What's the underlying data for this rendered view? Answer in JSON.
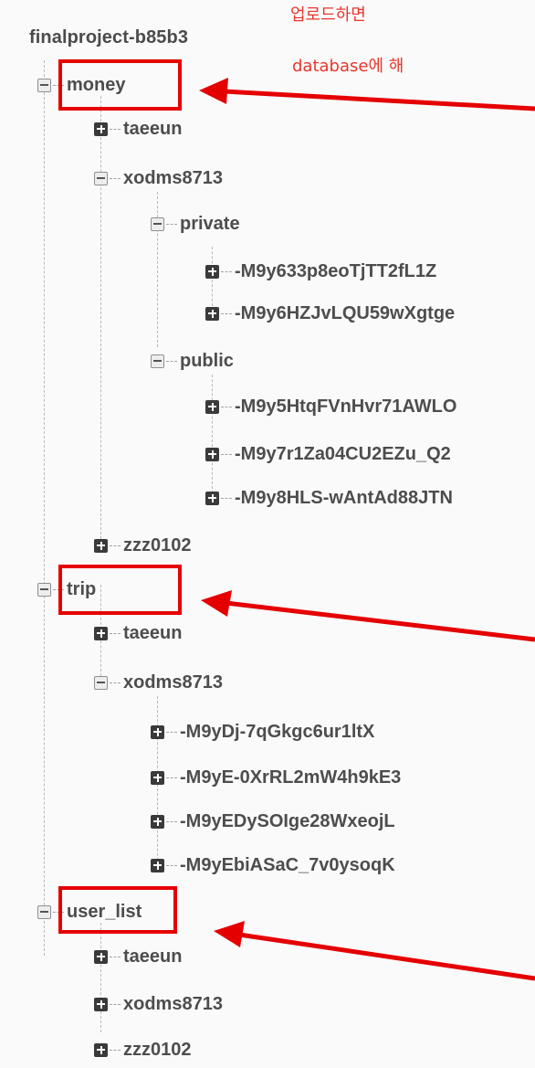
{
  "root": {
    "title": "finalproject-b85b3"
  },
  "annotations": {
    "line1": "업로드하면",
    "line2": "database에 해"
  },
  "tree": {
    "money": {
      "label": "money",
      "children": {
        "taeeun": "taeeun",
        "xodms8713": {
          "label": "xodms8713",
          "private": {
            "label": "private",
            "items": [
              "-M9y633p8eoTjTT2fL1Z",
              "-M9y6HZJvLQU59wXgtge"
            ]
          },
          "public": {
            "label": "public",
            "items": [
              "-M9y5HtqFVnHvr71AWLO",
              "-M9y7r1Za04CU2EZu_Q2",
              "-M9y8HLS-wAntAd88JTN"
            ]
          }
        },
        "zzz0102": "zzz0102"
      }
    },
    "trip": {
      "label": "trip",
      "children": {
        "taeeun": "taeeun",
        "xodms8713": {
          "label": "xodms8713",
          "items": [
            "-M9yDj-7qGkgc6ur1ltX",
            "-M9yE-0XrRL2mW4h9kE3",
            "-M9yEDySOIge28WxeojL",
            "-M9yEbiASaC_7v0ysoqK"
          ]
        }
      }
    },
    "user_list": {
      "label": "user_list",
      "children": [
        "taeeun",
        "xodms8713",
        "zzz0102"
      ]
    }
  },
  "colors": {
    "highlight": "#e50000",
    "arrow": "#e50000",
    "text": "#4d4d4d"
  }
}
